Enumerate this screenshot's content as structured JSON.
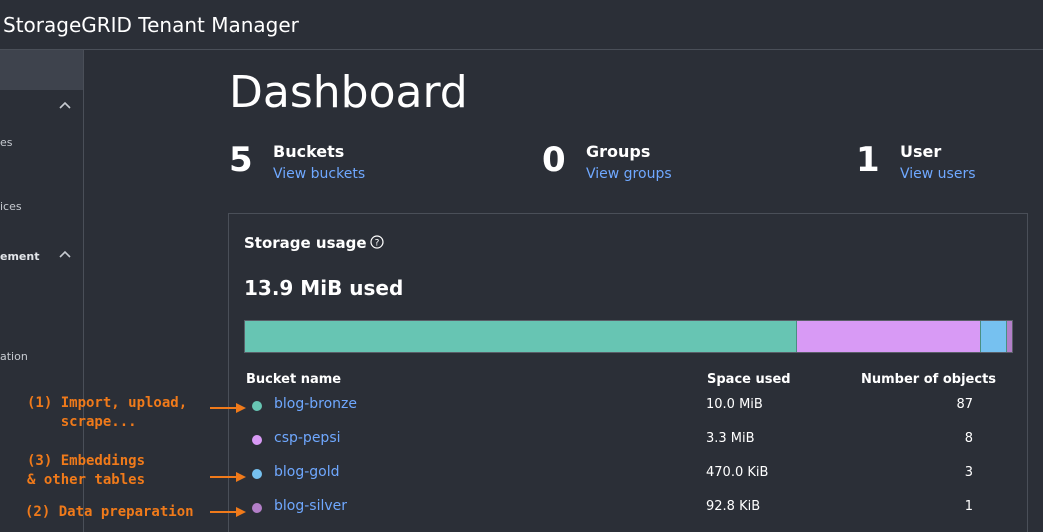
{
  "app": {
    "title": "StorageGRID Tenant Manager"
  },
  "sidebar": {
    "fragments": [
      "es",
      "ices",
      "ement",
      "ation"
    ]
  },
  "dashboard": {
    "title": "Dashboard",
    "stats": [
      {
        "count": "5",
        "label": "Buckets",
        "link": "View buckets"
      },
      {
        "count": "0",
        "label": "Groups",
        "link": "View groups"
      },
      {
        "count": "1",
        "label": "User",
        "link": "View users"
      }
    ]
  },
  "storage": {
    "title": "Storage usage",
    "used": "13.9 MiB used",
    "columns": {
      "name": "Bucket name",
      "space": "Space used",
      "objects": "Number of objects"
    },
    "buckets": [
      {
        "name": "blog-bronze",
        "space": "10.0 MiB",
        "objects": "87",
        "color": "#67c5b3"
      },
      {
        "name": "csp-pepsi",
        "space": "3.3 MiB",
        "objects": "8",
        "color": "#d89af5"
      },
      {
        "name": "blog-gold",
        "space": "470.0 KiB",
        "objects": "3",
        "color": "#76c1f0"
      },
      {
        "name": "blog-silver",
        "space": "92.8 KiB",
        "objects": "1",
        "color": "#b37fc8"
      }
    ],
    "usage_fractions": [
      0.718,
      0.24,
      0.034,
      0.008
    ]
  },
  "annotations": [
    {
      "text": "(1) Import, upload,\n    scrape..."
    },
    {
      "text": "(3) Embeddings\n& other tables"
    },
    {
      "text": "(2) Data preparation"
    }
  ],
  "colors": {
    "accent_link": "#6fa8ff",
    "annotation": "#f07a1a",
    "background": "#2b2f37"
  }
}
